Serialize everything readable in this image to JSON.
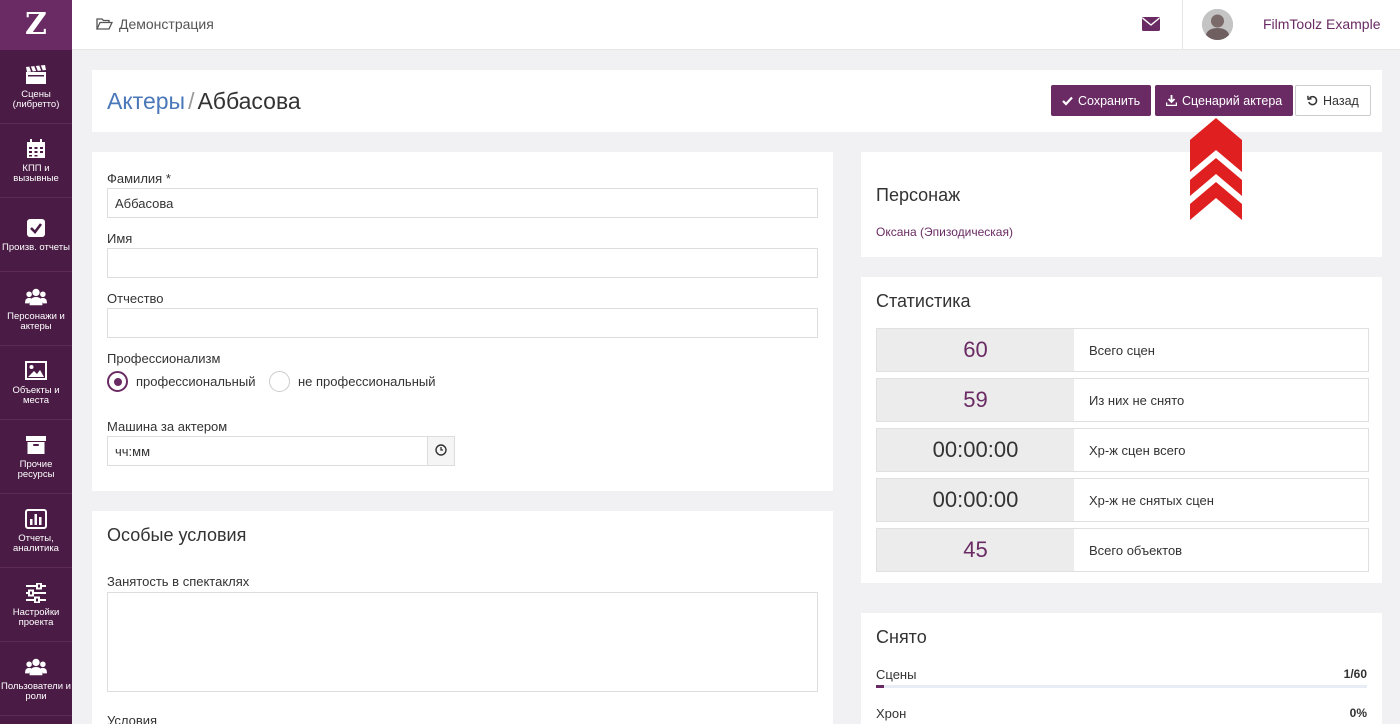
{
  "sidebar": {
    "logo": "Z",
    "items": [
      {
        "label": "Сцены (либретто)",
        "icon": "clapperboard-icon"
      },
      {
        "label": "КПП и вызывные",
        "icon": "calendar-icon"
      },
      {
        "label": "Произв. отчеты",
        "icon": "checkbox-icon"
      },
      {
        "label": "Персонажи и актеры",
        "icon": "users-icon"
      },
      {
        "label": "Объекты и места",
        "icon": "image-icon"
      },
      {
        "label": "Прочие ресурсы",
        "icon": "archive-icon"
      },
      {
        "label": "Отчеты, аналитика",
        "icon": "bar-chart-icon"
      },
      {
        "label": "Настройки проекта",
        "icon": "sliders-icon"
      },
      {
        "label": "Пользователи и роли",
        "icon": "users-icon"
      }
    ]
  },
  "topbar": {
    "breadcrumb": "Демонстрация",
    "user_name": "FilmToolz Example"
  },
  "header": {
    "title_link": "Актеры",
    "separator": "/",
    "title_current": "Аббасова",
    "save_label": "Сохранить",
    "script_label": "Сценарий актера",
    "back_label": "Назад"
  },
  "form": {
    "surname_label": "Фамилия",
    "required_mark": "*",
    "surname_value": "Аббасова",
    "name_label": "Имя",
    "name_value": "",
    "patronymic_label": "Отчество",
    "patronymic_value": "",
    "prof_label": "Профессионализм",
    "prof_options": [
      {
        "label": "профессиональный",
        "selected": true
      },
      {
        "label": "не профессиональный",
        "selected": false
      }
    ],
    "car_label": "Машина за актером",
    "car_placeholder": "чч:мм"
  },
  "special": {
    "title": "Особые условия",
    "busy_label": "Занятость в спектаклях",
    "conditions_label": "Условия"
  },
  "character": {
    "title": "Персонаж",
    "link": "Оксана (Эпизодическая)"
  },
  "statistics": {
    "title": "Статистика",
    "rows": [
      {
        "value": "60",
        "label": "Всего сцен",
        "tone": "purple"
      },
      {
        "value": "59",
        "label": "Из них не снято",
        "tone": "purple"
      },
      {
        "value": "00:00:00",
        "label": "Хр-ж сцен всего",
        "tone": "dark"
      },
      {
        "value": "00:00:00",
        "label": "Хр-ж не снятых сцен",
        "tone": "dark"
      },
      {
        "value": "45",
        "label": "Всего объектов",
        "tone": "purple"
      }
    ]
  },
  "shot": {
    "title": "Снято",
    "scenes_label": "Сцены",
    "scenes_value": "1/60",
    "scenes_fraction": 0.0167,
    "chron_label": "Хрон",
    "chron_value": "0%",
    "chron_fraction": 0
  },
  "colors": {
    "brand": "#6a2b64",
    "sidebar": "#4a1c45",
    "link": "#4a78b8",
    "annotation": "#e02020"
  }
}
